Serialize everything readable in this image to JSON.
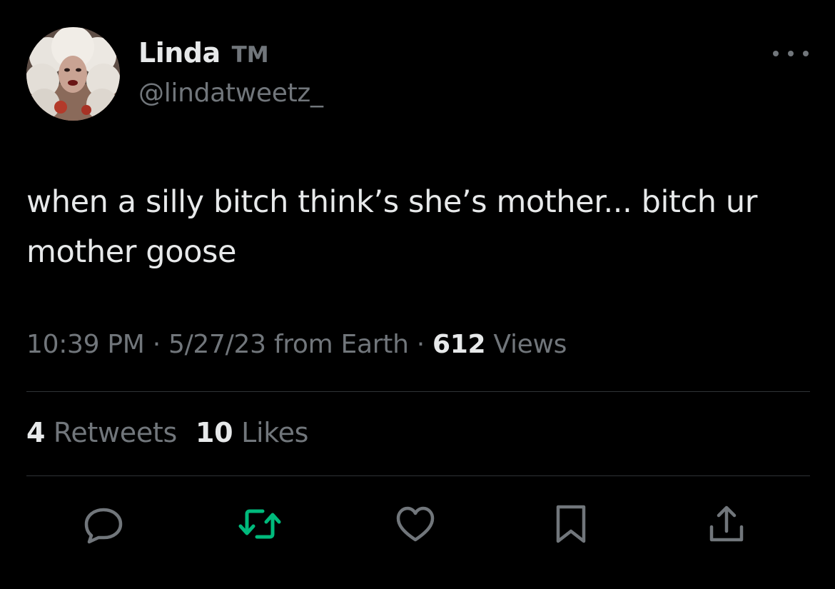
{
  "tweet": {
    "author": {
      "display_name": "Linda",
      "name_suffix": "TM",
      "handle": "@lindatweetz_"
    },
    "text_line1": "when a silly bitch think’s she’s mother... bitch ur",
    "text_line2": "mother goose",
    "meta": {
      "time": "10:39 PM",
      "sep1": " · ",
      "date_source": "5/27/23 from Earth",
      "sep2": " · ",
      "views_count": "612",
      "views_label": " Views"
    },
    "stats": {
      "retweets_count": "4",
      "retweets_label": " Retweets",
      "likes_count": "10",
      "likes_label": " Likes"
    },
    "actions": [
      {
        "icon": "reply-icon",
        "color": "#71767b"
      },
      {
        "icon": "retweet-icon",
        "color": "#00ba7c"
      },
      {
        "icon": "like-icon",
        "color": "#71767b"
      },
      {
        "icon": "bookmark-icon",
        "color": "#71767b"
      },
      {
        "icon": "share-icon",
        "color": "#71767b"
      }
    ]
  },
  "colors": {
    "background": "#000000",
    "primary_text": "#e7e9ea",
    "secondary_text": "#71767b",
    "divider": "#2f3336",
    "retweet_active": "#00ba7c"
  }
}
